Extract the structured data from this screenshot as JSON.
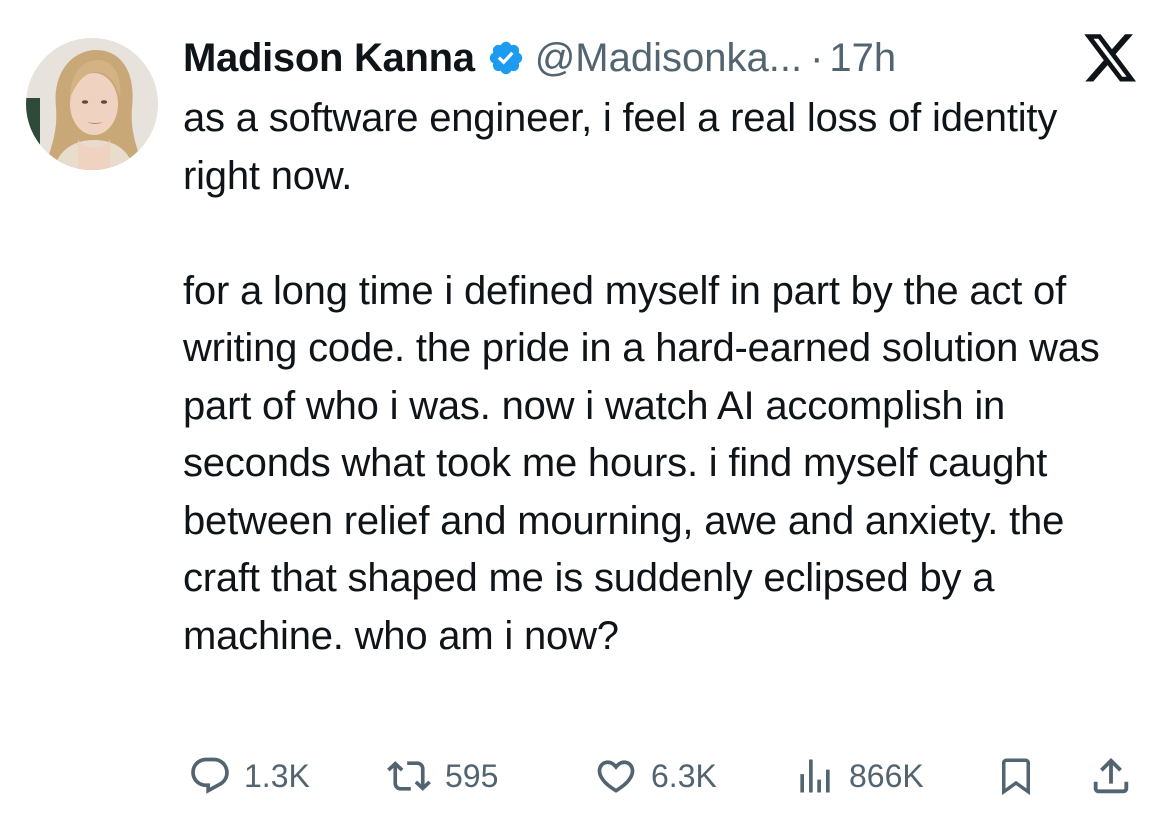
{
  "author": {
    "display_name": "Madison Kanna",
    "handle": "@Madisonka...",
    "separator": "·",
    "timestamp": "17h",
    "verified_icon": "verified-badge-icon",
    "avatar": "profile-photo"
  },
  "brand": {
    "logo": "x-logo-icon"
  },
  "tweet": {
    "paragraphs": [
      "as a software engineer, i feel a real loss of identity right now.",
      "for a long time i defined myself in part by the act of writing code. the pride in a hard-earned solution was part of who i was. now i watch AI accomplish in seconds what took me hours. i find myself caught between relief and mourning, awe and anxiety. the craft that shaped me is suddenly eclipsed by a machine. who am i now?"
    ]
  },
  "actions": {
    "reply": {
      "icon": "reply-icon",
      "count": "1.3K"
    },
    "repost": {
      "icon": "repost-icon",
      "count": "595"
    },
    "like": {
      "icon": "heart-icon",
      "count": "6.3K"
    },
    "views": {
      "icon": "views-icon",
      "count": "866K"
    },
    "bookmark": {
      "icon": "bookmark-icon"
    },
    "share": {
      "icon": "share-icon"
    }
  },
  "colors": {
    "text_primary": "#0f1419",
    "text_secondary": "#536471",
    "verified": "#1d9bf0",
    "background": "#ffffff"
  }
}
